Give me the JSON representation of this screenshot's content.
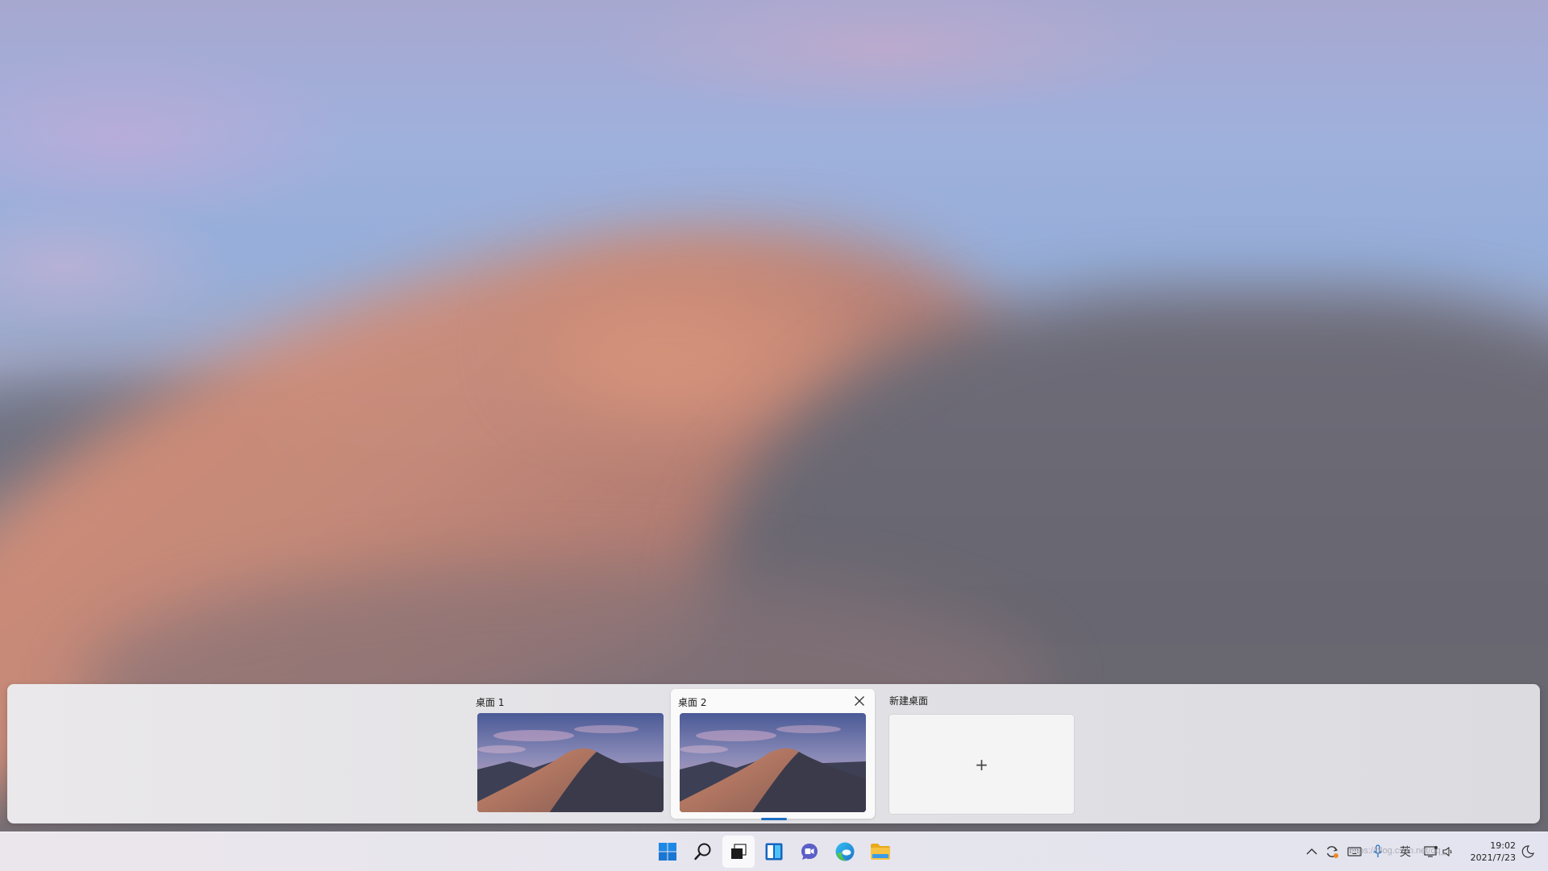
{
  "desktops": [
    {
      "label": "桌面 1",
      "active": false
    },
    {
      "label": "桌面 2",
      "active": true
    }
  ],
  "new_desktop": {
    "label": "新建桌面",
    "plus": "+"
  },
  "taskbar": {
    "apps": [
      {
        "name": "start",
        "icon": "windows-logo-icon"
      },
      {
        "name": "search",
        "icon": "search-icon"
      },
      {
        "name": "task-view",
        "icon": "task-view-icon",
        "active": true
      },
      {
        "name": "widgets",
        "icon": "widgets-icon"
      },
      {
        "name": "teams-chat",
        "icon": "teams-chat-icon"
      },
      {
        "name": "edge",
        "icon": "edge-icon"
      },
      {
        "name": "file-explorer",
        "icon": "folder-icon"
      }
    ],
    "tray": {
      "ime": "英",
      "time": "19:02",
      "date": "2021/7/23"
    }
  },
  "watermark": "https://blog.csdn.net/qq_...",
  "colors": {
    "accent": "#1b6ec2",
    "win_blue": "#0f7bdf",
    "folder_yellow": "#f5c242"
  }
}
